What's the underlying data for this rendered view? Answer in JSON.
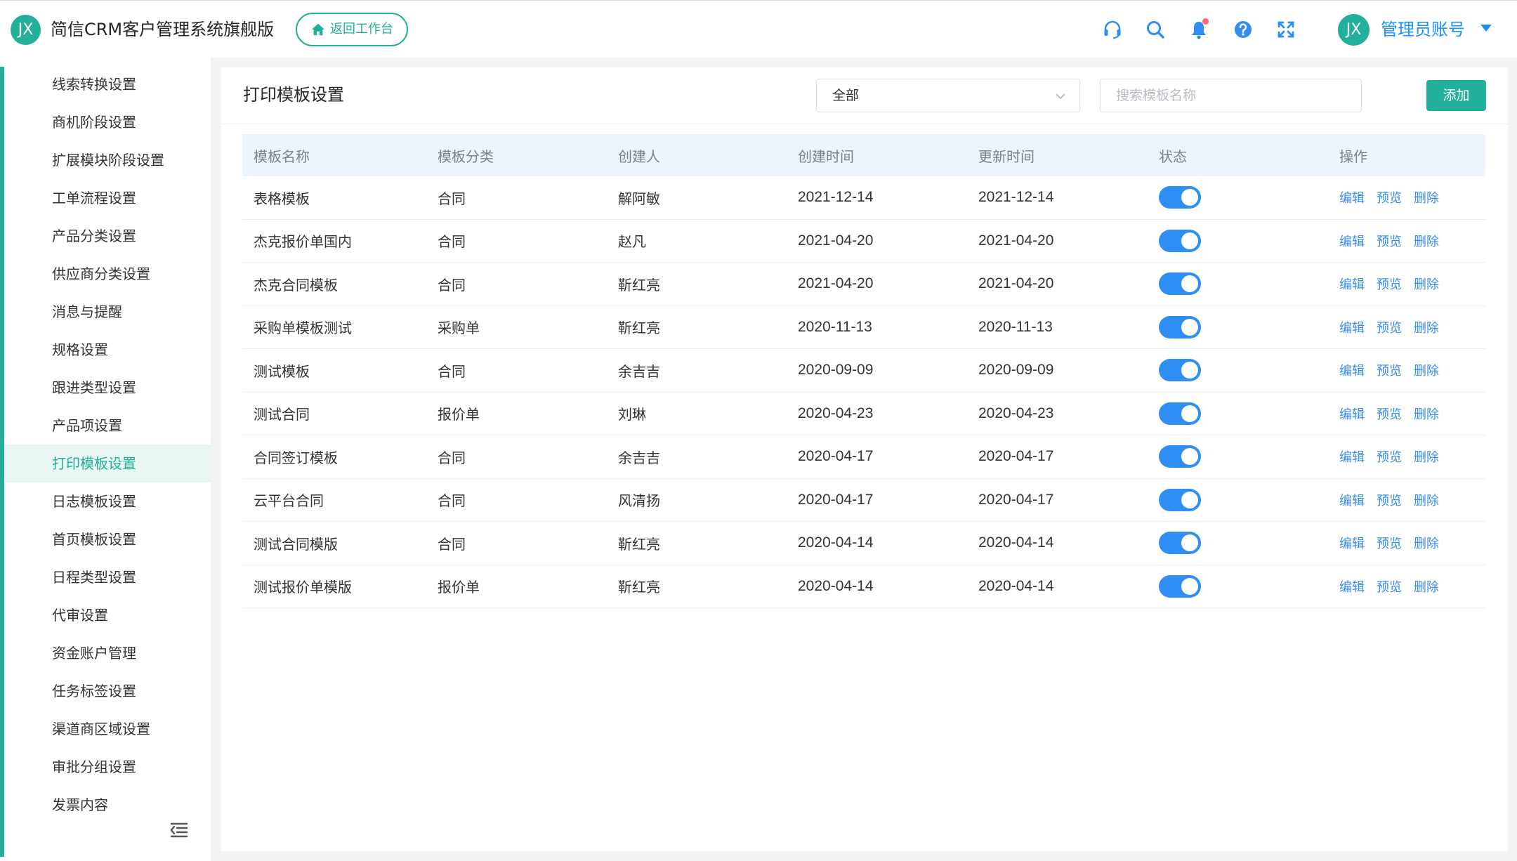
{
  "header": {
    "logo_text": "JX",
    "app_title": "简信CRM客户管理系统旗舰版",
    "back_label": "返回工作台",
    "avatar_text": "JX",
    "account_name": "管理员账号",
    "icons": [
      "headset-icon",
      "search-icon",
      "bell-icon",
      "help-icon",
      "fullscreen-icon"
    ]
  },
  "sidebar": {
    "items": [
      {
        "label": "线索转换设置",
        "active": false
      },
      {
        "label": "商机阶段设置",
        "active": false
      },
      {
        "label": "扩展模块阶段设置",
        "active": false
      },
      {
        "label": "工单流程设置",
        "active": false
      },
      {
        "label": "产品分类设置",
        "active": false
      },
      {
        "label": "供应商分类设置",
        "active": false
      },
      {
        "label": "消息与提醒",
        "active": false
      },
      {
        "label": "规格设置",
        "active": false
      },
      {
        "label": "跟进类型设置",
        "active": false
      },
      {
        "label": "产品项设置",
        "active": false
      },
      {
        "label": "打印模板设置",
        "active": true
      },
      {
        "label": "日志模板设置",
        "active": false
      },
      {
        "label": "首页模板设置",
        "active": false
      },
      {
        "label": "日程类型设置",
        "active": false
      },
      {
        "label": "代审设置",
        "active": false
      },
      {
        "label": "资金账户管理",
        "active": false
      },
      {
        "label": "任务标签设置",
        "active": false
      },
      {
        "label": "渠道商区域设置",
        "active": false
      },
      {
        "label": "审批分组设置",
        "active": false
      },
      {
        "label": "发票内容",
        "active": false
      }
    ]
  },
  "panel": {
    "title": "打印模板设置",
    "filter_value": "全部",
    "search_placeholder": "搜索模板名称",
    "add_label": "添加"
  },
  "table": {
    "columns": [
      "模板名称",
      "模板分类",
      "创建人",
      "创建时间",
      "更新时间",
      "状态",
      "操作"
    ],
    "actions": [
      "编辑",
      "预览",
      "删除"
    ],
    "rows": [
      {
        "name": "表格模板",
        "category": "合同",
        "creator": "解阿敏",
        "created": "2021-12-14",
        "updated": "2021-12-14",
        "enabled": true
      },
      {
        "name": "杰克报价单国内",
        "category": "合同",
        "creator": "赵凡",
        "created": "2021-04-20",
        "updated": "2021-04-20",
        "enabled": true
      },
      {
        "name": "杰克合同模板",
        "category": "合同",
        "creator": "靳红亮",
        "created": "2021-04-20",
        "updated": "2021-04-20",
        "enabled": true
      },
      {
        "name": "采购单模板测试",
        "category": "采购单",
        "creator": "靳红亮",
        "created": "2020-11-13",
        "updated": "2020-11-13",
        "enabled": true
      },
      {
        "name": "测试模板",
        "category": "合同",
        "creator": "余吉吉",
        "created": "2020-09-09",
        "updated": "2020-09-09",
        "enabled": true
      },
      {
        "name": "测试合同",
        "category": "报价单",
        "creator": "刘琳",
        "created": "2020-04-23",
        "updated": "2020-04-23",
        "enabled": true
      },
      {
        "name": "合同签订模板",
        "category": "合同",
        "creator": "余吉吉",
        "created": "2020-04-17",
        "updated": "2020-04-17",
        "enabled": true
      },
      {
        "name": "云平台合同",
        "category": "合同",
        "creator": "风清扬",
        "created": "2020-04-17",
        "updated": "2020-04-17",
        "enabled": true
      },
      {
        "name": "测试合同模版",
        "category": "合同",
        "creator": "靳红亮",
        "created": "2020-04-14",
        "updated": "2020-04-14",
        "enabled": true
      },
      {
        "name": "测试报价单模版",
        "category": "报价单",
        "creator": "靳红亮",
        "created": "2020-04-14",
        "updated": "2020-04-14",
        "enabled": true
      }
    ]
  },
  "colors": {
    "brand": "#23b09a",
    "link": "#3a8ee6",
    "toggle_on": "#2f8ef3",
    "account": "#1890ff"
  }
}
